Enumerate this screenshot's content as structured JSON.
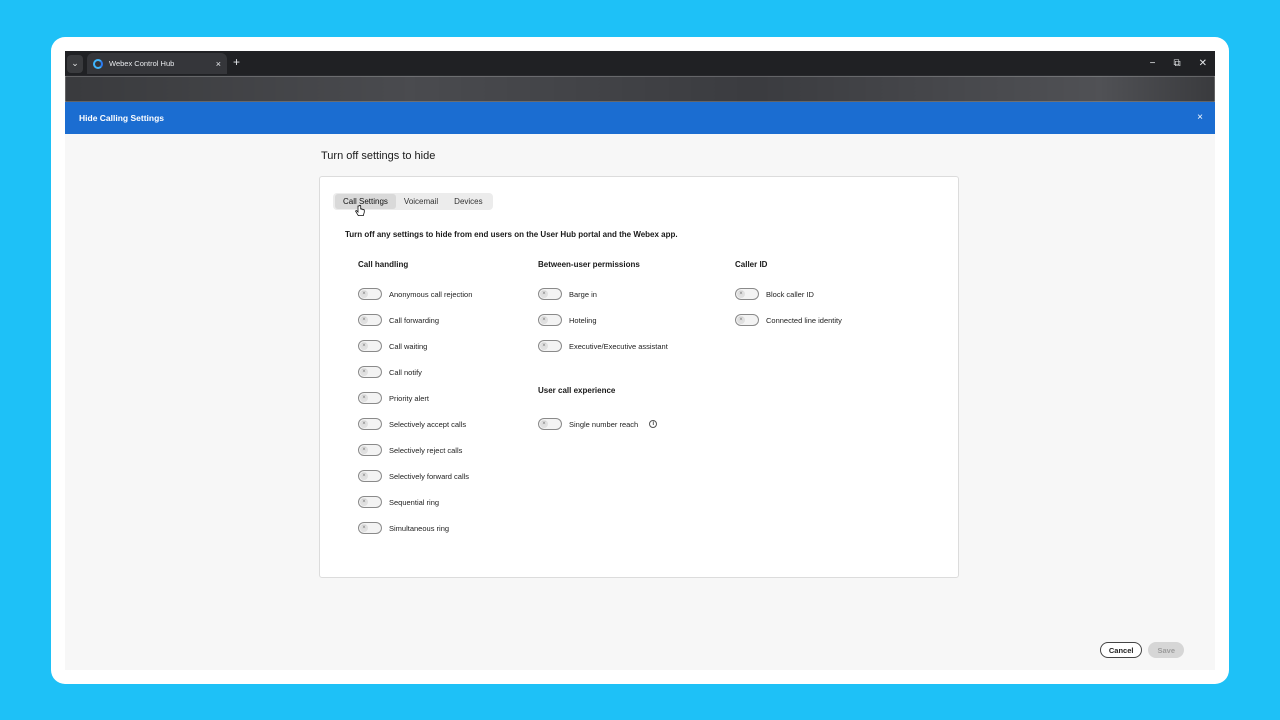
{
  "browser": {
    "tab_title": "Webex Control Hub",
    "tab_close": "×",
    "new_tab": "+",
    "menu": "⌄",
    "minimize": "−",
    "restore": "⧉",
    "close": "✕"
  },
  "header": {
    "title": "Hide Calling Settings",
    "close": "×"
  },
  "page": {
    "heading": "Turn off settings to hide",
    "description": "Turn off any settings to hide from end users on the User Hub portal and the Webex app."
  },
  "tabs": [
    {
      "label": "Call Settings",
      "active": true
    },
    {
      "label": "Voicemail",
      "active": false
    },
    {
      "label": "Devices",
      "active": false
    }
  ],
  "columns": {
    "call_handling": {
      "title": "Call handling",
      "items": [
        "Anonymous call rejection",
        "Call forwarding",
        "Call waiting",
        "Call notify",
        "Priority alert",
        "Selectively accept calls",
        "Selectively reject calls",
        "Selectively forward calls",
        "Sequential ring",
        "Simultaneous ring"
      ]
    },
    "between_user": {
      "title": "Between-user permissions",
      "items": [
        "Barge in",
        "Hoteling",
        "Executive/Executive assistant"
      ]
    },
    "user_call_experience": {
      "title": "User call experience",
      "items": [
        "Single number reach"
      ]
    },
    "caller_id": {
      "title": "Caller ID",
      "items": [
        "Block caller ID",
        "Connected line identity"
      ]
    }
  },
  "toggle_off_symbol": "×",
  "info_symbol": "i",
  "footer": {
    "cancel": "Cancel",
    "save": "Save"
  },
  "colors": {
    "background": "#1ec1f7",
    "header": "#1b6dd1",
    "tabstrip": "#202124"
  }
}
